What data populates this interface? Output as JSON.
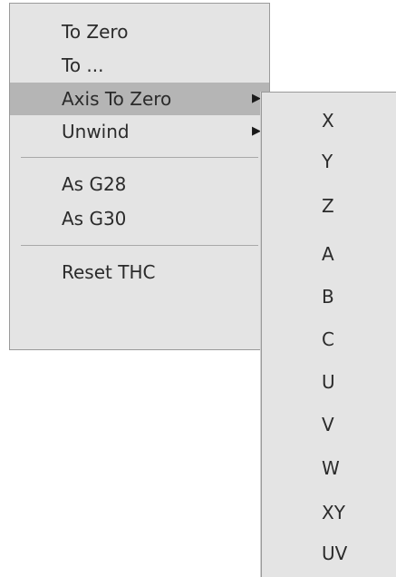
{
  "main_menu": {
    "items": [
      {
        "label": "To Zero"
      },
      {
        "label": "To ..."
      },
      {
        "label": "Axis To Zero",
        "has_submenu": true,
        "active": true
      },
      {
        "label": "Unwind",
        "has_submenu": true
      },
      {
        "label": "As G28"
      },
      {
        "label": "As G30"
      },
      {
        "label": "Reset THC"
      }
    ],
    "submenu_arrow": "▶"
  },
  "submenu": {
    "items": [
      {
        "label": "X"
      },
      {
        "label": "Y"
      },
      {
        "label": "Z"
      },
      {
        "label": "A"
      },
      {
        "label": "B"
      },
      {
        "label": "C"
      },
      {
        "label": "U"
      },
      {
        "label": "V"
      },
      {
        "label": "W"
      },
      {
        "label": "XY"
      },
      {
        "label": "UV"
      }
    ]
  },
  "colors": {
    "menu_bg": "#e4e4e4",
    "highlight_bg": "#b5b5b5",
    "text": "#2b2b2b",
    "border": "#9a9a9a"
  }
}
